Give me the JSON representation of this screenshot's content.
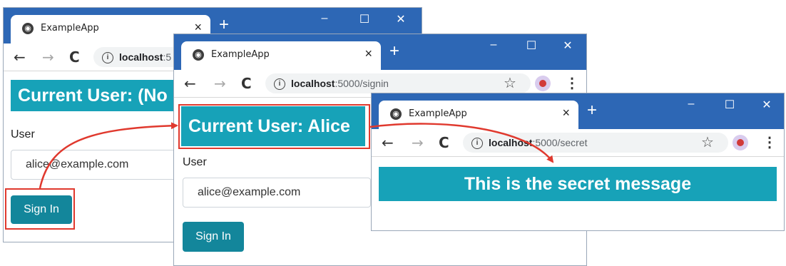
{
  "browser": {
    "tab_title": "ExampleApp",
    "close_glyph": "×",
    "new_tab_glyph": "+",
    "minimize_glyph": "–",
    "maximize_glyph": "☐",
    "window_close_glyph": "✕",
    "back_glyph": "←",
    "forward_glyph": "→",
    "reload_glyph": "C",
    "info_glyph": "i",
    "star_glyph": "☆",
    "menu_glyph": "⋮",
    "host": "localhost",
    "titlebar_color": "#2d67b5"
  },
  "window1": {
    "address_host": "localhost",
    "address_path": ":5",
    "banner": "Current User: (No",
    "user_label": "User",
    "user_value": "alice@example.com",
    "signin_label": "Sign In"
  },
  "window2": {
    "address_host": "localhost",
    "address_path": ":5000/signin",
    "banner": "Current User: Alice",
    "user_label": "User",
    "user_value": "alice@example.com",
    "signin_label": "Sign In"
  },
  "window3": {
    "address_host": "localhost",
    "address_path": ":5000/secret",
    "banner": "This is the secret message"
  },
  "colors": {
    "banner": "#17a2b8",
    "button": "#13869b",
    "highlight": "#e0392e"
  }
}
